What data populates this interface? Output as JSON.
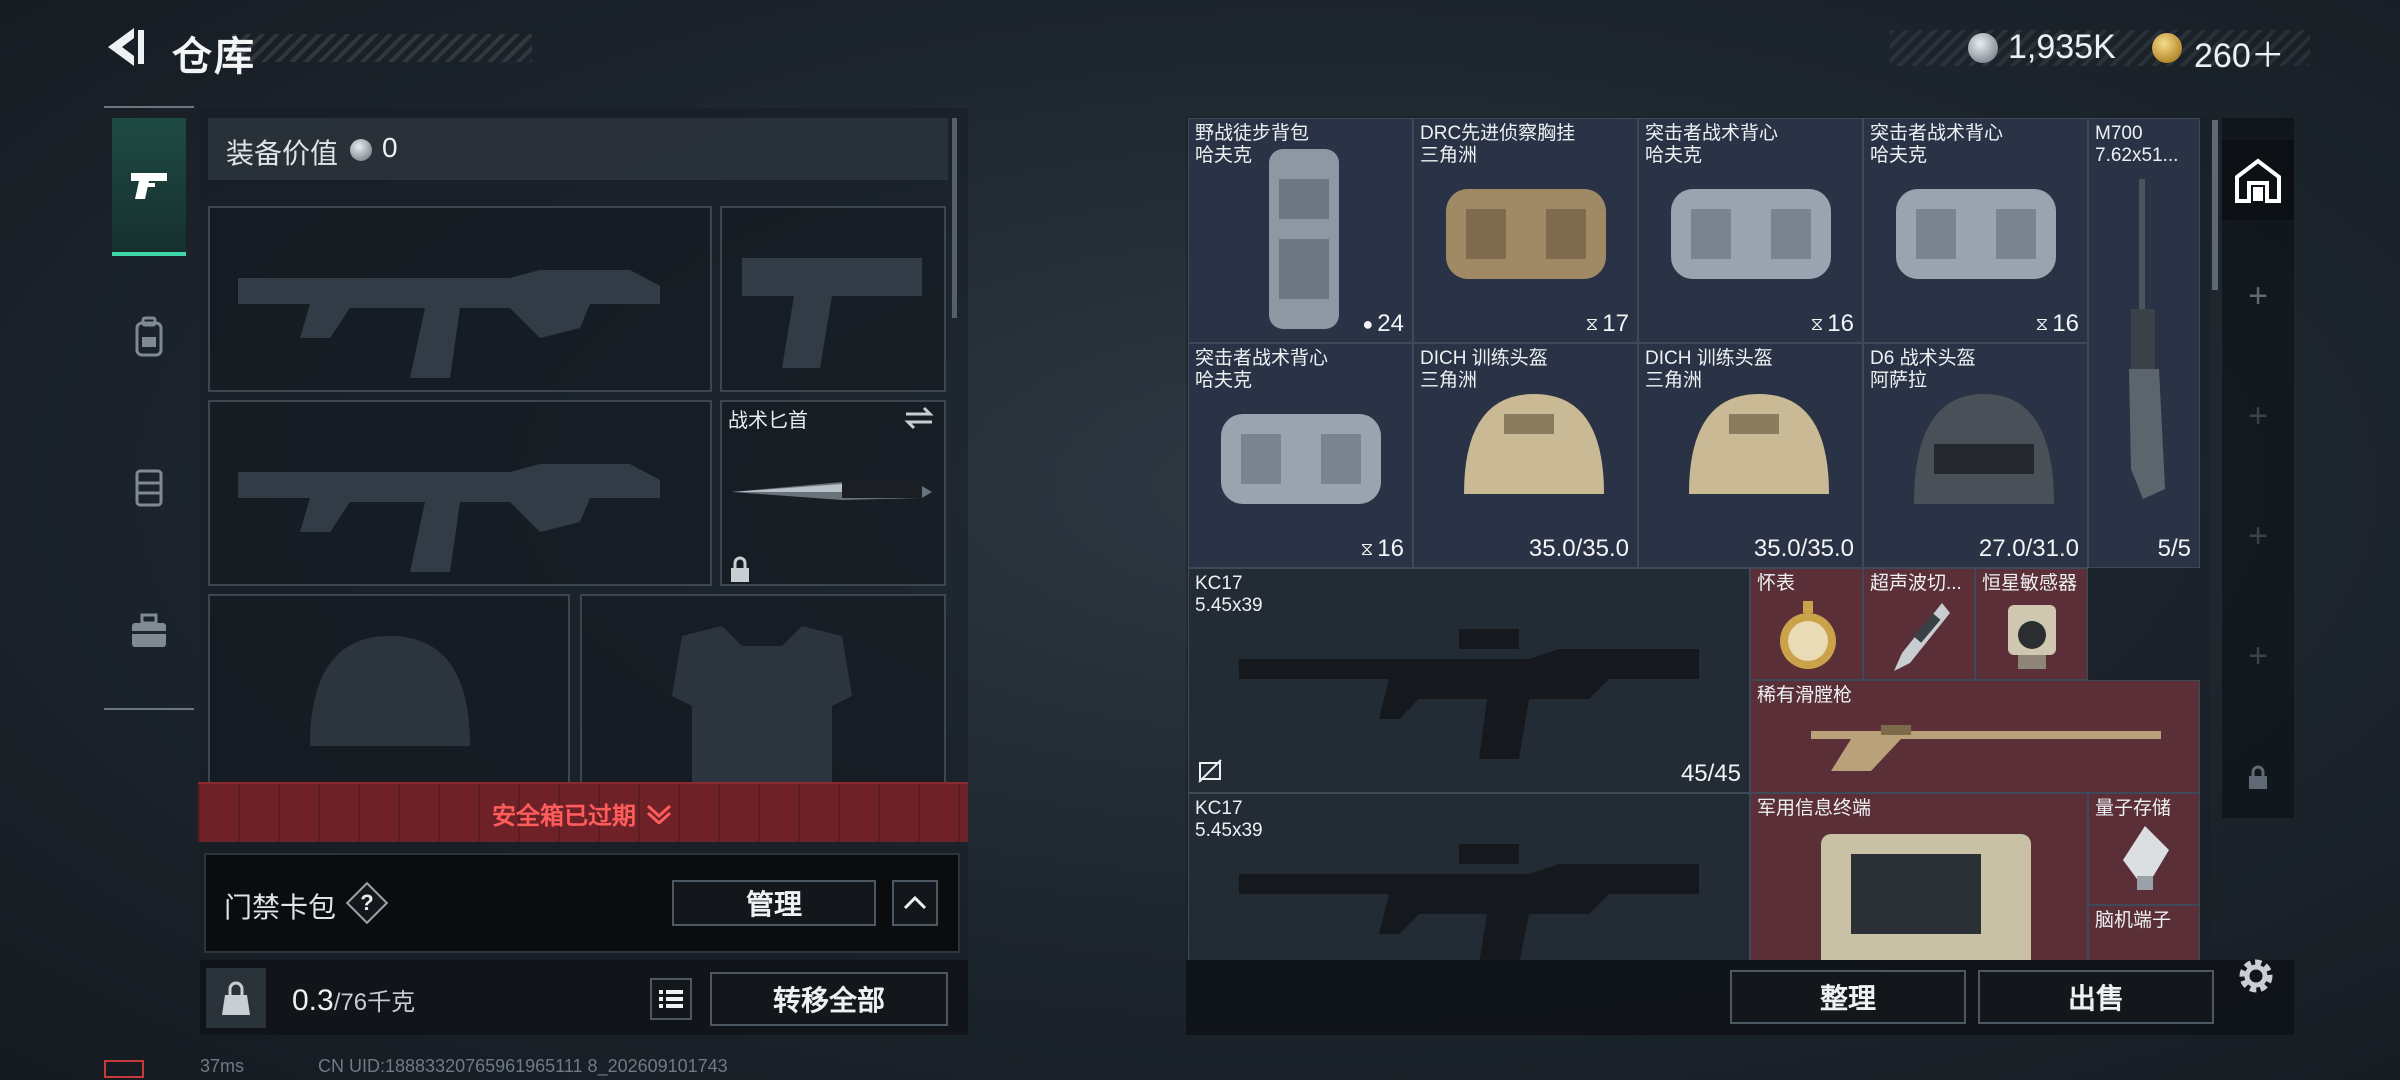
{
  "header": {
    "title": "仓库",
    "currency_silver": "1,935K",
    "currency_gold": "260＋"
  },
  "categories": [
    {
      "icon": "pistol-icon",
      "active": true
    },
    {
      "icon": "backpack-icon",
      "active": false
    },
    {
      "icon": "chest-rig-icon",
      "active": false
    },
    {
      "icon": "toolbox-icon",
      "active": false
    }
  ],
  "loadout": {
    "value_label": "装备价值",
    "value": "0",
    "knife_label": "战术匕首",
    "safebox_status": "安全箱已过期",
    "card_pack_label": "门禁卡包",
    "help_glyph": "?",
    "manage_button": "管理",
    "weight_current": "0.3",
    "weight_max": "/76千克",
    "transfer_all_button": "转移全部"
  },
  "status_bar": {
    "ping": "37ms",
    "uid": "CN UID:18883320765961965111 8_202609101743"
  },
  "storage": {
    "items": [
      {
        "name": "野战徒步背包",
        "sub": "哈夫克",
        "badge": "24",
        "badge_icon": "backpack-icon",
        "color": "blue"
      },
      {
        "name": "DRC先进侦察胸挂",
        "sub": "三角洲",
        "badge": "17",
        "badge_icon": "vest-icon",
        "color": "blue"
      },
      {
        "name": "突击者战术背心",
        "sub": "哈夫克",
        "badge": "16",
        "badge_icon": "vest-icon",
        "color": "blue"
      },
      {
        "name": "突击者战术背心",
        "sub": "哈夫克",
        "badge": "16",
        "badge_icon": "vest-icon",
        "color": "blue"
      },
      {
        "name": "M700",
        "sub": "7.62x51...",
        "badge": "5/5",
        "color": "blue"
      },
      {
        "name": "突击者战术背心",
        "sub": "哈夫克",
        "badge": "16",
        "badge_icon": "vest-icon",
        "color": "blue"
      },
      {
        "name": "DICH 训练头盔",
        "sub": "三角洲",
        "badge": "35.0/35.0",
        "color": "blue"
      },
      {
        "name": "DICH 训练头盔",
        "sub": "三角洲",
        "badge": "35.0/35.0",
        "color": "blue"
      },
      {
        "name": "D6 战术头盔",
        "sub": "阿萨拉",
        "badge": "27.0/31.0",
        "color": "blue"
      },
      {
        "name": "KC17",
        "sub": "5.45x39",
        "badge": "45/45",
        "color": "dark"
      },
      {
        "name": "怀表",
        "color": "red"
      },
      {
        "name": "超声波切...",
        "color": "red"
      },
      {
        "name": "恒星敏感器",
        "color": "red"
      },
      {
        "name": "稀有滑膛枪",
        "color": "red"
      },
      {
        "name": "KC17",
        "sub": "5.45x39",
        "color": "dark"
      },
      {
        "name": "军用信息终端",
        "color": "red"
      },
      {
        "name": "量子存储",
        "color": "red"
      },
      {
        "name": "脑机端子",
        "color": "red"
      }
    ],
    "sort_button": "整理",
    "sell_button": "出售"
  },
  "colors": {
    "accent_green": "#3fd6a8",
    "item_blue": "#2a3345",
    "item_red": "#5a2f37",
    "warning_red": "#ff5c5c"
  }
}
